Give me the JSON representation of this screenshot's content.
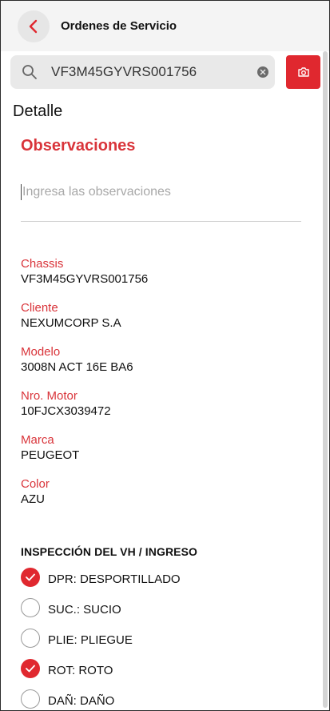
{
  "header": {
    "title": "Ordenes de Servicio",
    "back_icon": "chevron-left-icon"
  },
  "search": {
    "value": "VF3M45GYVRS001756",
    "search_icon": "search-icon",
    "clear_icon": "clear-icon",
    "camera_icon": "camera-icon"
  },
  "detail": {
    "title": "Detalle",
    "observations_title": "Observaciones",
    "observations_placeholder": "Ingresa las observaciones",
    "fields": [
      {
        "label": "Chassis",
        "value": "VF3M45GYVRS001756"
      },
      {
        "label": "Cliente",
        "value": "NEXUMCORP S.A"
      },
      {
        "label": "Modelo",
        "value": "3008N ACT 16E BA6"
      },
      {
        "label": "Nro. Motor",
        "value": "10FJCX3039472"
      },
      {
        "label": "Marca",
        "value": "PEUGEOT"
      },
      {
        "label": "Color",
        "value": "AZU"
      }
    ]
  },
  "inspection": {
    "title": "INSPECCIÓN DEL VH / INGRESO",
    "items": [
      {
        "label": "DPR: DESPORTILLADO",
        "checked": true
      },
      {
        "label": "SUC.: SUCIO",
        "checked": false
      },
      {
        "label": "PLIE: PLIEGUE",
        "checked": false
      },
      {
        "label": "ROT: ROTO",
        "checked": true
      },
      {
        "label": "DAÑ: DAÑO",
        "checked": false
      }
    ]
  },
  "colors": {
    "accent": "#e0282f",
    "label_red": "#d9343a",
    "header_bg": "#f4f4f4"
  }
}
